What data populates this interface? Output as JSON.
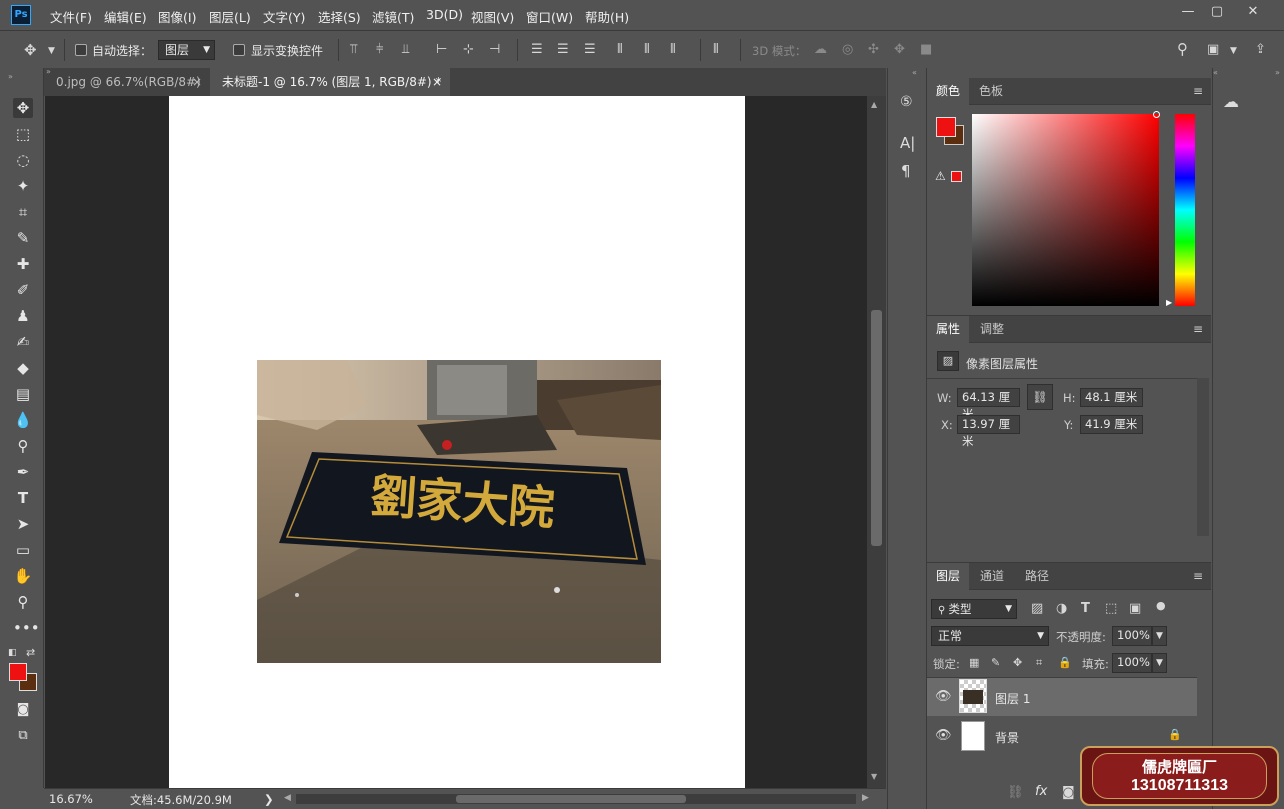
{
  "app": {
    "logo": "Ps"
  },
  "menu": [
    "文件(F)",
    "编辑(E)",
    "图像(I)",
    "图层(L)",
    "文字(Y)",
    "选择(S)",
    "滤镜(T)",
    "3D(D)",
    "视图(V)",
    "窗口(W)",
    "帮助(H)"
  ],
  "window_controls": {
    "minimize": "—",
    "maximize": "▢",
    "close": "✕"
  },
  "options": {
    "auto_select_label": "自动选择：",
    "auto_select_value": "图层",
    "show_transform_label": "显示变换控件",
    "mode3d_label": "3D 模式："
  },
  "tabs": [
    {
      "title": "0.jpg @ 66.7%(RGB/8#)",
      "close": "×"
    },
    {
      "title": "未标题-1 @ 16.7% (图层 1, RGB/8#) *",
      "close": "×"
    }
  ],
  "photo": {
    "sign_text": "劉家大院"
  },
  "status": {
    "zoom": "16.67%",
    "doc": "文档:45.6M/20.9M",
    "arrow": "❯"
  },
  "color_panel": {
    "tabs": [
      "颜色",
      "色板"
    ],
    "foreground": "#ee1111",
    "background": "#5a2e0e",
    "warning_icon": "warning-icon"
  },
  "properties_panel": {
    "tabs": [
      "属性",
      "调整"
    ],
    "title": "像素图层属性",
    "w_label": "W:",
    "w_value": "64.13 厘米",
    "h_label": "H:",
    "h_value": "48.1 厘米",
    "x_label": "X:",
    "x_value": "13.97 厘米",
    "y_label": "Y:",
    "y_value": "41.9 厘米"
  },
  "layers_panel": {
    "tabs": [
      "图层",
      "通道",
      "路径"
    ],
    "filter_label": "类型",
    "blend_mode": "正常",
    "opacity_label": "不透明度:",
    "opacity_value": "100%",
    "lock_label": "锁定:",
    "fill_label": "填充:",
    "fill_value": "100%",
    "layers": [
      {
        "name": "图层 1",
        "selected": true
      },
      {
        "name": "背景",
        "selected": false,
        "locked": true
      }
    ],
    "fx_label": "fx"
  },
  "watermark": {
    "line1": "儒虎牌匾厂",
    "line2": "13108711313"
  }
}
